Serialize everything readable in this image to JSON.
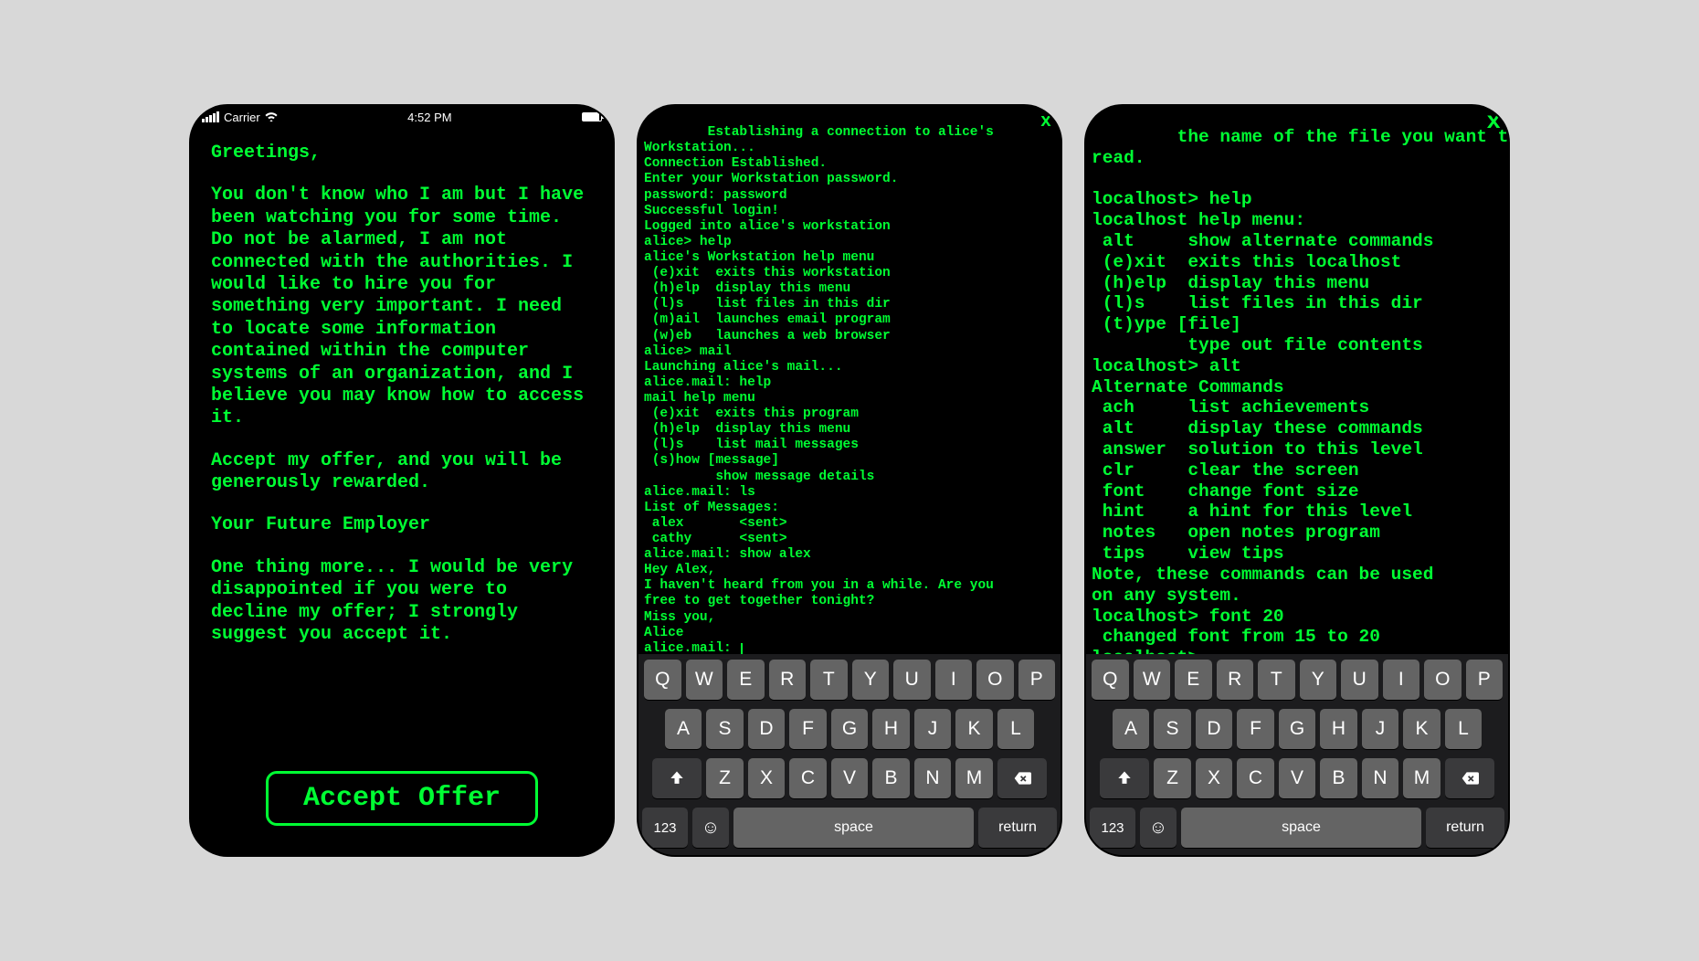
{
  "screen1": {
    "status": {
      "carrier": "Carrier",
      "time": "4:52 PM"
    },
    "paragraphs": [
      "Greetings,",
      "You don't know who I am but I have been watching you for some time. Do not be alarmed, I am not connected with the authorities. I would like to hire you for something very important. I need to locate some information contained within the computer systems of an organization, and I believe you may know how to access it.",
      "Accept my offer, and you will be generously rewarded.",
      "Your Future Employer",
      "One thing more... I would be very disappointed if you were to decline my offer; I strongly suggest you accept it."
    ],
    "button_label": "Accept Offer"
  },
  "screen2": {
    "close_label": "x",
    "terminal_text": "Establishing a connection to alice's\nWorkstation...\nConnection Established.\nEnter your Workstation password.\npassword: password\nSuccessful login!\nLogged into alice's workstation\nalice> help\nalice's Workstation help menu\n (e)xit  exits this workstation\n (h)elp  display this menu\n (l)s    list files in this dir\n (m)ail  launches email program\n (w)eb   launches a web browser\nalice> mail\nLaunching alice's mail...\nalice.mail: help\nmail help menu\n (e)xit  exits this program\n (h)elp  display this menu\n (l)s    list mail messages\n (s)how [message]\n         show message details\nalice.mail: ls\nList of Messages:\n alex       <sent>\n cathy      <sent>\nalice.mail: show alex\nHey Alex,\nI haven't heard from you in a while. Are you\nfree to get together tonight?\nMiss you,\nAlice\nalice.mail: "
  },
  "screen3": {
    "close_label": "x",
    "terminal_text": "the name of the file you want to\nread.\n\nlocalhost> help\nlocalhost help menu:\n alt     show alternate commands\n (e)xit  exits this localhost\n (h)elp  display this menu\n (l)s    list files in this dir\n (t)ype [file]\n         type out file contents\nlocalhost> alt\nAlternate Commands\n ach     list achievements\n alt     display these commands\n answer  solution to this level\n clr     clear the screen\n font    change font size\n hint    a hint for this level\n notes   open notes program\n tips    view tips\nNote, these commands can be used\non any system.\nlocalhost> font 20\n changed font from 15 to 20\nlocalhost>"
  },
  "keyboard": {
    "row1": [
      "Q",
      "W",
      "E",
      "R",
      "T",
      "Y",
      "U",
      "I",
      "O",
      "P"
    ],
    "row2": [
      "A",
      "S",
      "D",
      "F",
      "G",
      "H",
      "J",
      "K",
      "L"
    ],
    "row3": [
      "Z",
      "X",
      "C",
      "V",
      "B",
      "N",
      "M"
    ],
    "numkey": "123",
    "space": "space",
    "return": "return"
  }
}
